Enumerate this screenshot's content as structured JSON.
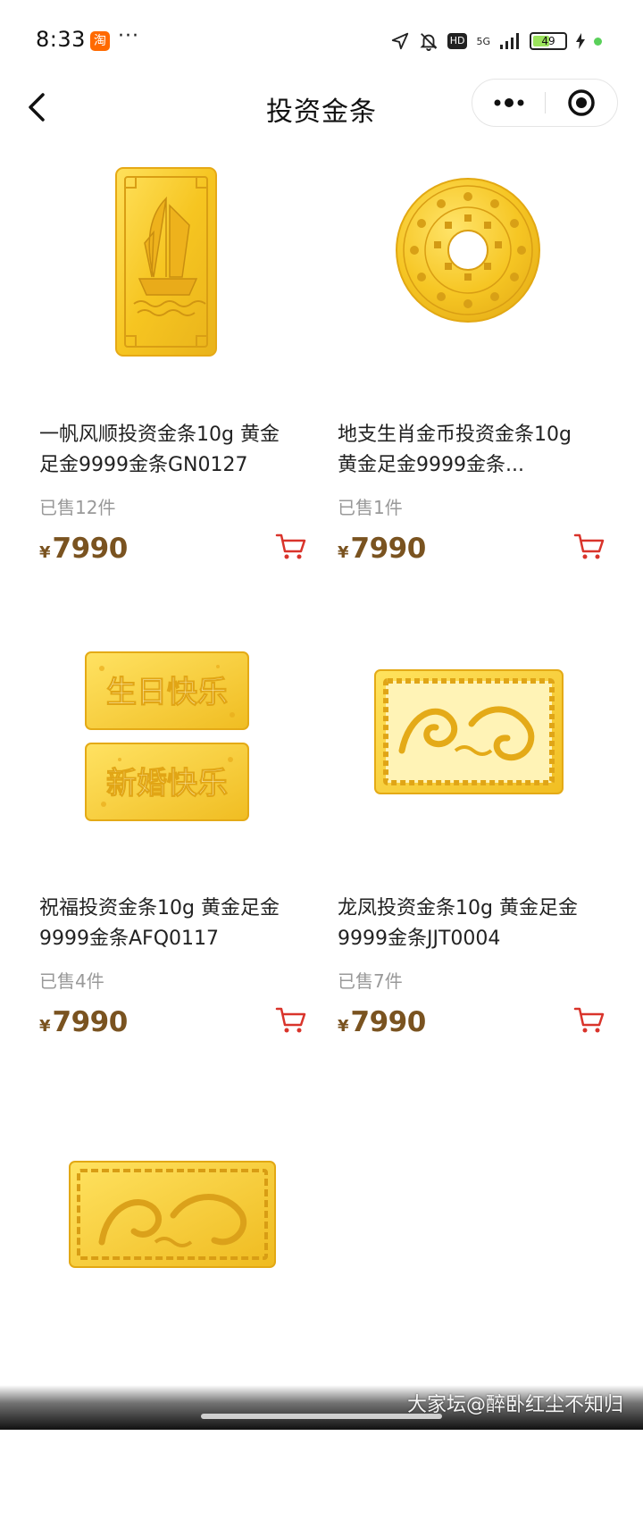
{
  "status_bar": {
    "time": "8:33",
    "app_badge": "淘",
    "more": "···",
    "hd": "HD",
    "network": "5G",
    "battery": "49"
  },
  "nav": {
    "title": "投资金条"
  },
  "products": [
    {
      "title": "一帆风顺投资金条10g 黄金足金9999金条GN0127",
      "sold": "已售12件",
      "currency": "¥",
      "price": "7990"
    },
    {
      "title": "地支生肖金币投资金条10g 黄金足金9999金条...",
      "sold": "已售1件",
      "currency": "¥",
      "price": "7990"
    },
    {
      "title": "祝福投资金条10g 黄金足金9999金条AFQ0117",
      "sold": "已售4件",
      "currency": "¥",
      "price": "7990"
    },
    {
      "title": "龙凤投资金条10g 黄金足金9999金条JJT0004",
      "sold": "已售7件",
      "currency": "¥",
      "price": "7990"
    }
  ],
  "gold_bar_text": {
    "birthday": "生日快乐",
    "wedding": "新婚快乐"
  },
  "watermark": "大家坛@醉卧红尘不知归",
  "colors": {
    "price": "#7a5320",
    "cart": "#d9342b",
    "gold": "#f3c42a"
  }
}
